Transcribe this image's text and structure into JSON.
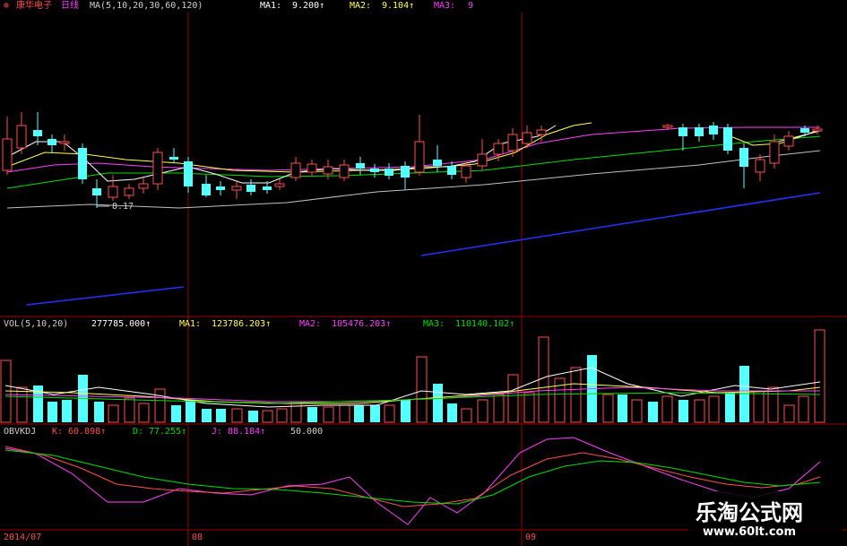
{
  "header": {
    "stock_name": "康华电子",
    "period": "日线",
    "ma_spec": "MA(5,10,20,30,60,120)",
    "ma1_label": "MA1:",
    "ma1_value": "9.200↑",
    "ma2_label": "MA2:",
    "ma2_value": "9.104↑",
    "ma3_label": "MA3:",
    "ma3_value": "9"
  },
  "price_panel": {
    "low_marker": "8.17"
  },
  "volume_panel": {
    "title": "VOL(5,10,20)",
    "vol_value": "277785.000↑",
    "ma1_label": "MA1:",
    "ma1_value": "123786.203↑",
    "ma2_label": "MA2:",
    "ma2_value": "105476.203↑",
    "ma3_label": "MA3:",
    "ma3_value": "110140.102↑"
  },
  "indicator_panel": {
    "title": "OBVKDJ",
    "k_label": "K:",
    "k_value": "60.898↑",
    "d_label": "D:",
    "d_value": "77.255↑",
    "j_label": "J:",
    "j_value": "88.184↑",
    "level": "50.000"
  },
  "time_axis": {
    "labels": [
      "2014/07",
      "08",
      "09"
    ]
  },
  "watermark": {
    "title": "乐淘公式网",
    "url": "www.60lt.com"
  },
  "colors": {
    "up": "#ff5050",
    "down": "#54ffff",
    "ma_white": "#ffffff",
    "ma_yellow": "#ffff4f",
    "ma_purple": "#ff40ff",
    "ma_green": "#00e000",
    "ma_gray": "#c0c0c0",
    "trend_blue": "#2233ff",
    "separator": "#a00000"
  },
  "chart_data": {
    "type": "candlestick",
    "series": [
      {
        "name": "MA1",
        "value": 9.2
      },
      {
        "name": "MA2",
        "value": 9.104
      },
      {
        "name": "MA3",
        "value": 9
      }
    ],
    "low_marker": 8.17,
    "volume": {
      "value": 277785.0,
      "ma1": 123786.203,
      "ma2": 105476.203,
      "ma3": 110140.102
    },
    "kdj": {
      "k": 60.898,
      "d": 77.255,
      "j": 88.184,
      "level": 50.0
    }
  }
}
